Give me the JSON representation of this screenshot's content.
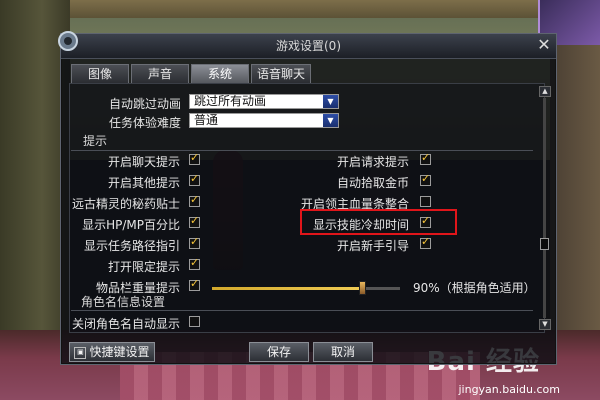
{
  "dialog": {
    "title": "游戏设置(0)",
    "close_label": "✕"
  },
  "tabs": [
    {
      "label": "图像",
      "active": false
    },
    {
      "label": "声音",
      "active": false
    },
    {
      "label": "系统",
      "active": true
    },
    {
      "label": "语音聊天",
      "active": false
    }
  ],
  "selects": {
    "skip_anim": {
      "label": "自动跳过动画",
      "value": "跳过所有动画"
    },
    "task_difficulty": {
      "label": "任务体验难度",
      "value": "普通"
    }
  },
  "section_hint": "提示",
  "left_options": [
    {
      "label": "开启聊天提示",
      "checked": true
    },
    {
      "label": "开启其他提示",
      "checked": true
    },
    {
      "label": "远古精灵的秘药贴士",
      "checked": true
    },
    {
      "label": "显示HP/MP百分比",
      "checked": true
    },
    {
      "label": "显示任务路径指引",
      "checked": true
    },
    {
      "label": "打开限定提示",
      "checked": true
    },
    {
      "label": "物品栏重量提示",
      "checked": true
    }
  ],
  "right_options": [
    {
      "label": "开启请求提示",
      "checked": true
    },
    {
      "label": "自动拾取金币",
      "checked": true
    },
    {
      "label": "开启领主血量条整合",
      "checked": false
    },
    {
      "label": "显示技能冷却时间",
      "checked": true
    },
    {
      "label": "开启新手引导",
      "checked": true
    }
  ],
  "weight_slider": {
    "value_percent": 90,
    "text": "90%（根据角色适用）"
  },
  "section_role": "角色名信息设置",
  "role_options": [
    {
      "label": "关闭角色名自动显示",
      "checked": false
    }
  ],
  "buttons": {
    "hotkey": "快捷键设置",
    "save": "保存",
    "cancel": "取消"
  },
  "watermark": {
    "brand": "Bai 经验",
    "url": "jingyan.baidu.com"
  },
  "colors": {
    "accent_gold": "#f4c43a",
    "highlight_red": "#e0151a",
    "select_arrow_blue": "#2e4ea8"
  }
}
